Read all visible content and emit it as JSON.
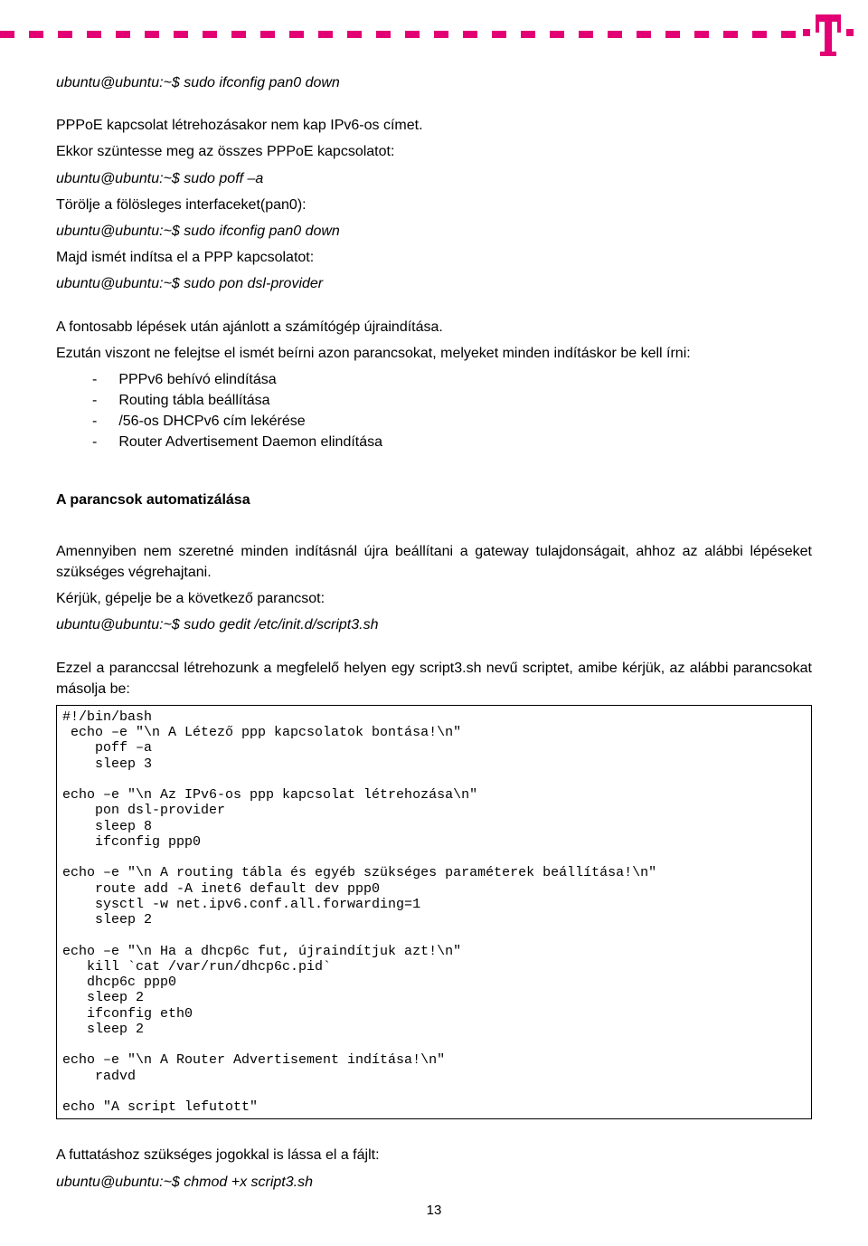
{
  "cmd1": "ubuntu@ubuntu:~$ sudo ifconfig pan0 down",
  "p1": "PPPoE kapcsolat létrehozásakor nem kap IPv6-os címet.",
  "p2": "Ekkor szüntesse meg az összes PPPoE kapcsolatot:",
  "cmd2": "ubuntu@ubuntu:~$ sudo poff –a",
  "p3": "Törölje a fölösleges interfaceket(pan0):",
  "cmd3": "ubuntu@ubuntu:~$ sudo ifconfig pan0 down",
  "p4": "Majd ismét indítsa el a PPP kapcsolatot:",
  "cmd4": "ubuntu@ubuntu:~$ sudo pon dsl-provider",
  "p5": "A fontosabb lépések után ajánlott a számítógép újraindítása.",
  "p6": "Ezután viszont ne felejtse el ismét beírni azon parancsokat, melyeket minden indításkor be kell írni:",
  "li1": "PPPv6 behívó elindítása",
  "li2": "Routing tábla beállítása",
  "li3": "/56-os DHCPv6 cím lekérése",
  "li4": "Router Advertisement Daemon elindítása",
  "h1": "A parancsok automatizálása",
  "p7": "Amennyiben nem szeretné minden indításnál újra beállítani a gateway tulajdonságait, ahhoz az alábbi lépéseket szükséges végrehajtani.",
  "p8": "Kérjük, gépelje be a következő parancsot:",
  "cmd5": "ubuntu@ubuntu:~$ sudo gedit /etc/init.d/script3.sh",
  "p9": "Ezzel a paranccsal létrehozunk a megfelelő helyen egy script3.sh nevű scriptet, amibe kérjük, az alábbi parancsokat másolja be:",
  "code": "#!/bin/bash\n echo –e \"\\n A Létező ppp kapcsolatok bontása!\\n\"\n    poff –a\n    sleep 3\n\necho –e \"\\n Az IPv6-os ppp kapcsolat létrehozása\\n\"\n    pon dsl-provider\n    sleep 8\n    ifconfig ppp0\n\necho –e \"\\n A routing tábla és egyéb szükséges paraméterek beállítása!\\n\"\n    route add -A inet6 default dev ppp0\n    sysctl -w net.ipv6.conf.all.forwarding=1\n    sleep 2\n\necho –e \"\\n Ha a dhcp6c fut, újraindítjuk azt!\\n\"\n   kill `cat /var/run/dhcp6c.pid`\n   dhcp6c ppp0\n   sleep 2\n   ifconfig eth0\n   sleep 2\n\necho –e \"\\n A Router Advertisement indítása!\\n\"\n    radvd\n\necho \"A script lefutott\"",
  "p10": "A futtatáshoz szükséges jogokkal is lássa el a fájlt:",
  "cmd6": "ubuntu@ubuntu:~$ chmod +x script3.sh",
  "pagenum": "13",
  "dash": "-"
}
